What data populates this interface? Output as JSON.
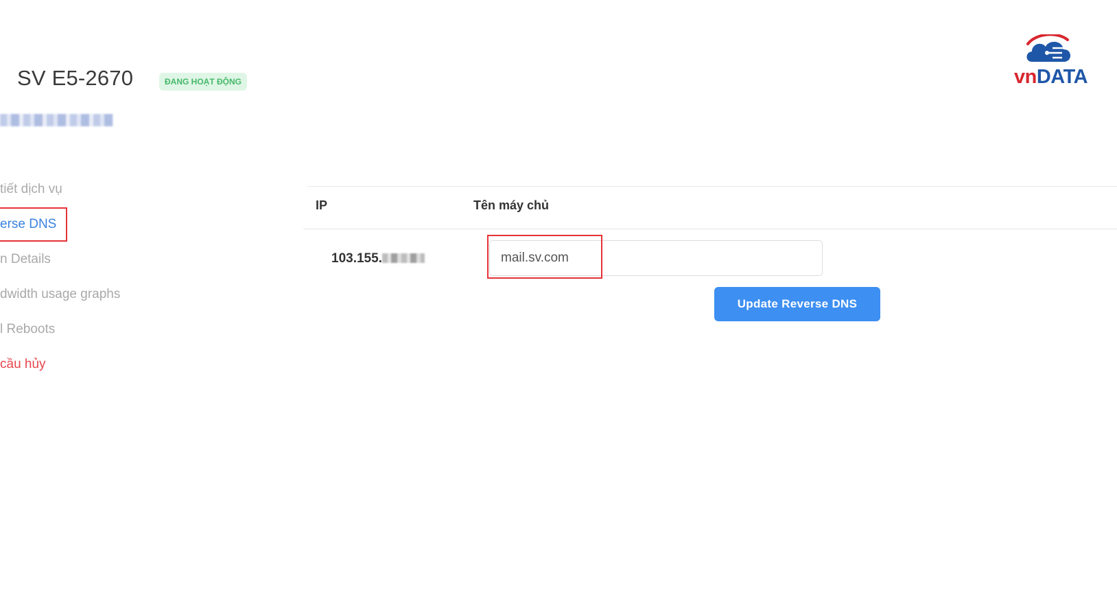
{
  "header": {
    "service_title": "SV E5-2670",
    "status_badge": "ĐANG HOẠT ĐỘNG",
    "status_color": "#46b86a"
  },
  "logo": {
    "text_vn": "vn",
    "text_data": "DATA",
    "vn_color": "#d8262f",
    "data_color": "#1f57a8"
  },
  "sidebar": {
    "items": [
      {
        "label": "tiết dịch vụ"
      },
      {
        "label": "erse DNS",
        "active": true
      },
      {
        "label": "n Details"
      },
      {
        "label": "dwidth usage graphs"
      },
      {
        "label": "l Reboots"
      },
      {
        "label": "cầu hủy",
        "danger": true
      }
    ]
  },
  "table": {
    "columns": [
      "IP",
      "Tên máy chủ"
    ],
    "rows": [
      {
        "ip_visible": "103.155.",
        "hostname": "mail.sv.com"
      }
    ]
  },
  "actions": {
    "update_label": "Update Reverse DNS",
    "accent": "#3d8ff2"
  }
}
